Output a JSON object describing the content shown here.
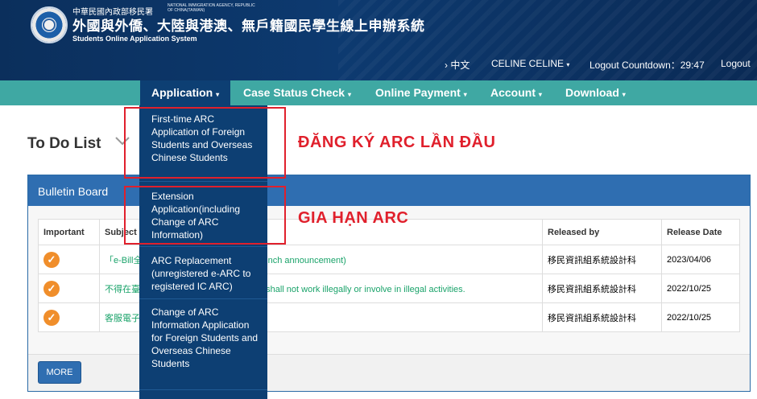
{
  "header": {
    "agency_zh": "中華民國內政部移民署",
    "agency_en": "NATIONAL IMMIGRATION AGENCY, REPUBLIC OF CHINA(TAIWAN)",
    "title": "外國與外僑、大陸與港澳、無戶籍國民學生線上申辦系統",
    "subtitle": "Students Online Application System",
    "topnav": {
      "language": "› 中文",
      "user": "CELINE CELINE",
      "countdown_label": "Logout Countdown：",
      "countdown_value": "29:47",
      "logout": "Logout"
    }
  },
  "menu": {
    "items": [
      "Application",
      "Case Status Check",
      "Online Payment",
      "Account",
      "Download"
    ]
  },
  "dropdown": {
    "items": [
      "First-time ARC Application of Foreign Students and Overseas Chinese Students",
      "Extension Application(including Change of ARC Information)",
      "ARC Replacement (unregistered e-ARC to registered IC ARC)",
      "Change of ARC Information Application for Foreign Students and Overseas Chinese Students"
    ]
  },
  "annotations": {
    "first": "ĐĂNG KÝ ARC LẦN ĐẦU",
    "second": "GIA HẠN ARC"
  },
  "todo": {
    "title": "To Do List"
  },
  "bulletin": {
    "title": "Bulletin Board",
    "columns": [
      "Important",
      "Subject",
      "Released by",
      "Release Date"
    ],
    "rows": [
      {
        "subject": "「e-Bill全",
        "subject_tail": "unch announcement)",
        "released_by": "移民資訊組系統設計科",
        "date": "2023/04/06"
      },
      {
        "subject": "不得在臺",
        "subject_tail": "t shall not work illegally or involve in illegal activities.",
        "released_by": "移民資訊組系統設計科",
        "date": "2022/10/25"
      },
      {
        "subject": "客服電子",
        "subject_tail": "",
        "released_by": "移民資訊組系統設計科",
        "date": "2022/10/25"
      }
    ],
    "more": "MORE"
  },
  "colors": {
    "header_bg": "#0d3a70",
    "menubar_bg": "#3fa8a3",
    "dropdown_bg": "#0d3f73",
    "panel_head": "#2f6eb1",
    "annotation_red": "#e0202c",
    "important_orange": "#f08e2b",
    "subject_green": "#1aa36a"
  },
  "icons": [
    "emblem-logo",
    "chevron-down-icon",
    "check-circle-icon"
  ]
}
